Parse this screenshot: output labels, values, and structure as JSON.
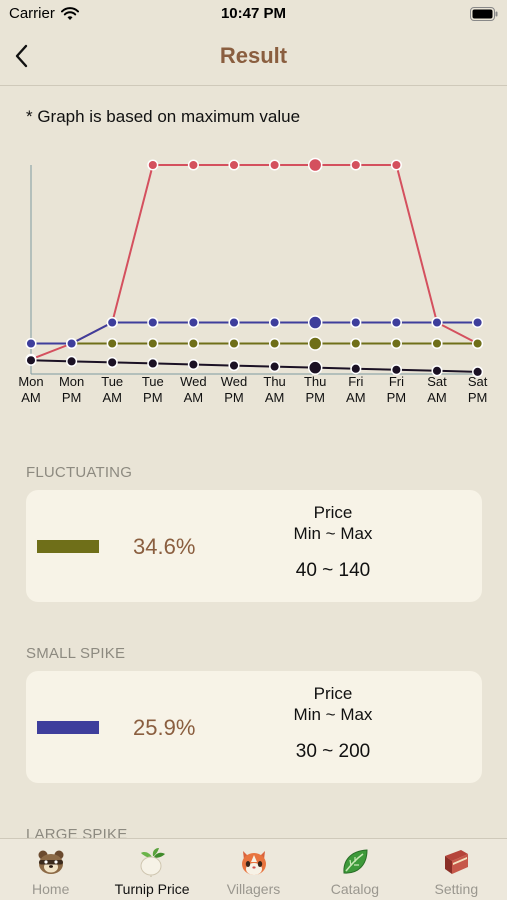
{
  "status_bar": {
    "carrier": "Carrier",
    "time": "10:47 PM"
  },
  "nav": {
    "title": "Result"
  },
  "note": "* Graph is based on maximum value",
  "chart_data": {
    "type": "line",
    "categories": [
      [
        "Mon",
        "AM"
      ],
      [
        "Mon",
        "PM"
      ],
      [
        "Tue",
        "AM"
      ],
      [
        "Tue",
        "PM"
      ],
      [
        "Wed",
        "AM"
      ],
      [
        "Wed",
        "PM"
      ],
      [
        "Thu",
        "AM"
      ],
      [
        "Thu",
        "PM"
      ],
      [
        "Fri",
        "AM"
      ],
      [
        "Fri",
        "PM"
      ],
      [
        "Sat",
        "AM"
      ],
      [
        "Sat",
        "PM"
      ]
    ],
    "highlight_index": 7,
    "ylim": [
      0,
      200
    ],
    "series": [
      {
        "color": "#d4505e",
        "values": [
          15,
          30,
          50,
          200,
          200,
          200,
          200,
          200,
          200,
          200,
          50,
          30
        ]
      },
      {
        "color": "#3e3e9c",
        "values": [
          30,
          30,
          50,
          50,
          50,
          50,
          50,
          50,
          50,
          50,
          50,
          50
        ]
      },
      {
        "color": "#6f6f19",
        "values": [
          30,
          30,
          30,
          30,
          30,
          30,
          30,
          30,
          30,
          30,
          30,
          30
        ]
      },
      {
        "color": "#1b1124",
        "values": [
          14,
          13,
          12,
          11,
          10,
          9,
          8,
          7,
          6,
          5,
          4,
          3
        ]
      }
    ]
  },
  "sections": [
    {
      "label": "FLUCTUATING",
      "color": "#6f6f19",
      "percent": "34.6%",
      "price_title": "Price",
      "price_sub": "Min ~ Max",
      "price_range": "40 ~ 140"
    },
    {
      "label": "SMALL SPIKE",
      "color": "#3e3e9c",
      "percent": "25.9%",
      "price_title": "Price",
      "price_sub": "Min ~ Max",
      "price_range": "30 ~ 200"
    },
    {
      "label": "LARGE SPIKE"
    }
  ],
  "tabs": [
    {
      "label": "Home",
      "icon": "raccoon-icon"
    },
    {
      "label": "Turnip Price",
      "icon": "turnip-icon"
    },
    {
      "label": "Villagers",
      "icon": "villager-cat-icon"
    },
    {
      "label": "Catalog",
      "icon": "leaf-icon"
    },
    {
      "label": "Setting",
      "icon": "book-icon"
    }
  ]
}
